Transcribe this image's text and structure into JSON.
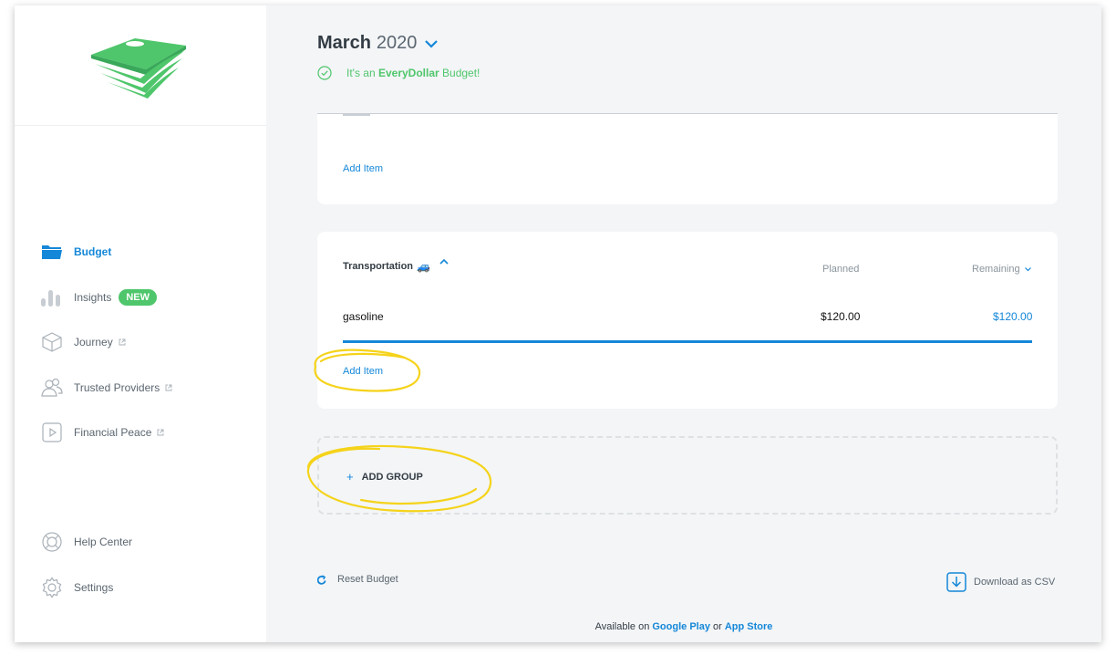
{
  "app": {
    "name": "EveryDollar",
    "brand_green": "#4fc66b",
    "accent_blue": "#1487d8",
    "annotation_yellow": "#f5d31a"
  },
  "sidebar": {
    "logo_icon": "money-stack-logo",
    "items": [
      {
        "label": "Budget",
        "icon": "folder-icon",
        "active": true,
        "external": false
      },
      {
        "label": "Insights",
        "icon": "bar-chart-icon",
        "badge": "NEW",
        "external": false
      },
      {
        "label": "Journey",
        "icon": "cube-icon",
        "external": true
      },
      {
        "label": "Trusted Providers",
        "icon": "people-icon",
        "external": true
      },
      {
        "label": "Financial Peace",
        "icon": "play-icon",
        "external": true
      }
    ],
    "bottom": [
      {
        "label": "Help Center",
        "icon": "lifebuoy-icon"
      },
      {
        "label": "Settings",
        "icon": "gear-icon"
      }
    ]
  },
  "header": {
    "month": "March",
    "year": "2020",
    "banner_prefix": "It's an ",
    "banner_brand": "EveryDollar",
    "banner_suffix": " Budget!"
  },
  "groups": [
    {
      "add_item_label": "Add Item"
    },
    {
      "title": "Transportation",
      "emoji": "🚙",
      "col_planned": "Planned",
      "col_remaining": "Remaining",
      "items": [
        {
          "name": "gasoline",
          "planned": "$120.00",
          "remaining": "$120.00",
          "progress_fraction": 1.0
        }
      ],
      "add_item_label": "Add Item"
    }
  ],
  "add_group": {
    "plus": "+",
    "label": "ADD GROUP"
  },
  "footer": {
    "reset_label": "Reset Budget",
    "csv_label": "Download as CSV",
    "available_prefix": "Available on ",
    "store_1": "Google Play",
    "joiner": " or ",
    "store_2": "App Store"
  }
}
